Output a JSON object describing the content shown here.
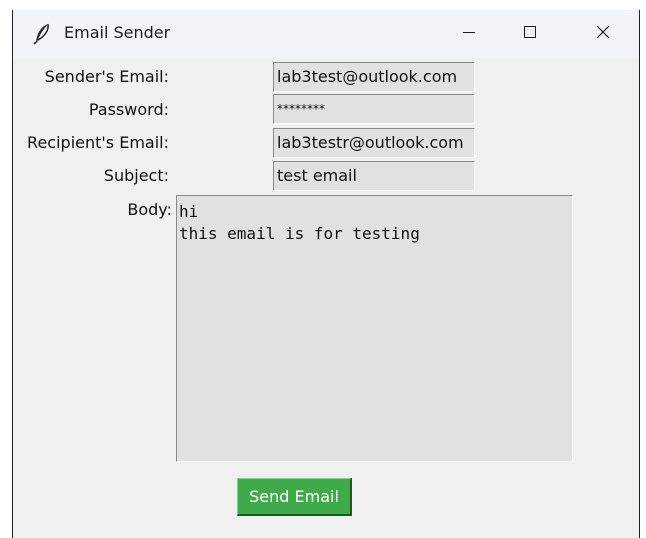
{
  "window": {
    "title": "Email Sender",
    "icon": "feather-icon",
    "controls": [
      "minimize-icon",
      "maximize-icon",
      "close-icon"
    ]
  },
  "form": {
    "sender": {
      "label": "Sender's Email:",
      "value": "lab3test@outlook.com"
    },
    "password": {
      "label": "Password:",
      "value": "********"
    },
    "recipient": {
      "label": "Recipient's Email:",
      "value": "lab3testr@outlook.com"
    },
    "subject": {
      "label": "Subject:",
      "value": "test email"
    },
    "body": {
      "label": "Body:",
      "value": "hi\nthis email is for testing"
    }
  },
  "actions": {
    "send_label": "Send Email",
    "send_color": "#3faa4a"
  }
}
